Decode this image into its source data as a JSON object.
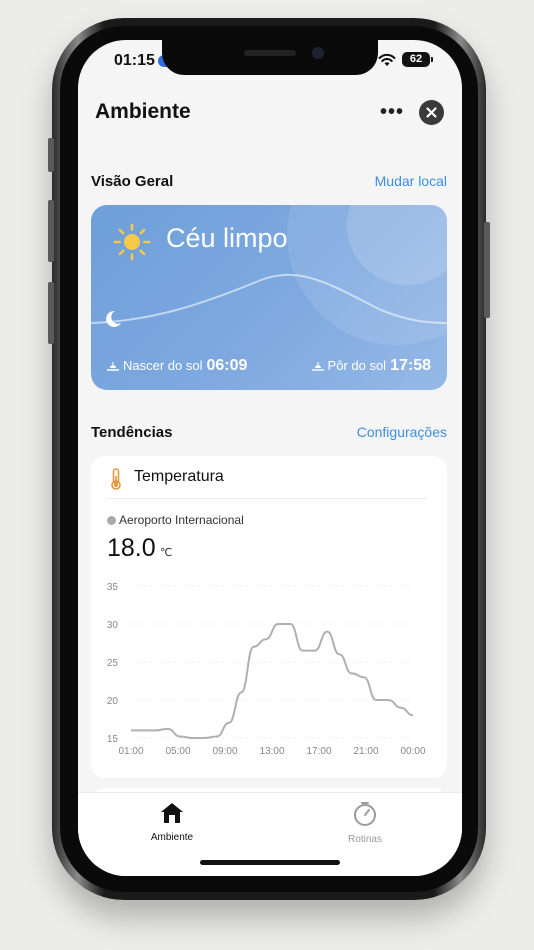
{
  "status_bar": {
    "time": "01:15",
    "battery": "62"
  },
  "header": {
    "title": "Ambiente"
  },
  "overview": {
    "label": "Visão Geral",
    "change_location": "Mudar local",
    "condition": "Céu limpo",
    "sunrise_label": "Nascer do sol",
    "sunrise_time": "06:09",
    "sunset_label": "Pôr do sol",
    "sunset_time": "17:58"
  },
  "trends": {
    "label": "Tendências",
    "settings": "Configurações"
  },
  "temperature_card": {
    "title": "Temperatura",
    "source": "Aeroporto Internacional",
    "value": "18.0",
    "unit": "℃"
  },
  "chart_data": {
    "type": "line",
    "x_ticks": [
      "01:00",
      "05:00",
      "09:00",
      "13:00",
      "17:00",
      "21:00",
      "00:00"
    ],
    "y_ticks": [
      15,
      20,
      25,
      30,
      35
    ],
    "ylim": [
      15,
      35
    ],
    "grid": true,
    "series_color": "#b0b0b0",
    "values": [
      {
        "t": 0,
        "v": 16
      },
      {
        "t": 2,
        "v": 16
      },
      {
        "t": 3,
        "v": 16.2
      },
      {
        "t": 4,
        "v": 15.2
      },
      {
        "t": 5,
        "v": 15
      },
      {
        "t": 6,
        "v": 15
      },
      {
        "t": 7,
        "v": 15.2
      },
      {
        "t": 8,
        "v": 17
      },
      {
        "t": 9,
        "v": 21
      },
      {
        "t": 10,
        "v": 27
      },
      {
        "t": 11,
        "v": 28
      },
      {
        "t": 12,
        "v": 30
      },
      {
        "t": 13,
        "v": 30
      },
      {
        "t": 14,
        "v": 26.5
      },
      {
        "t": 15,
        "v": 26.5
      },
      {
        "t": 16,
        "v": 29
      },
      {
        "t": 17,
        "v": 26
      },
      {
        "t": 18,
        "v": 23.5
      },
      {
        "t": 19,
        "v": 23
      },
      {
        "t": 20,
        "v": 20
      },
      {
        "t": 21,
        "v": 20
      },
      {
        "t": 22,
        "v": 19
      },
      {
        "t": 23,
        "v": 18
      }
    ]
  },
  "tabbar": {
    "tabs": [
      {
        "label": "Ambiente",
        "active": true
      },
      {
        "label": "Rotinas",
        "active": false
      }
    ]
  },
  "colors": {
    "accent": "#3d8fdf",
    "weather_card": "#7fa9e0"
  }
}
